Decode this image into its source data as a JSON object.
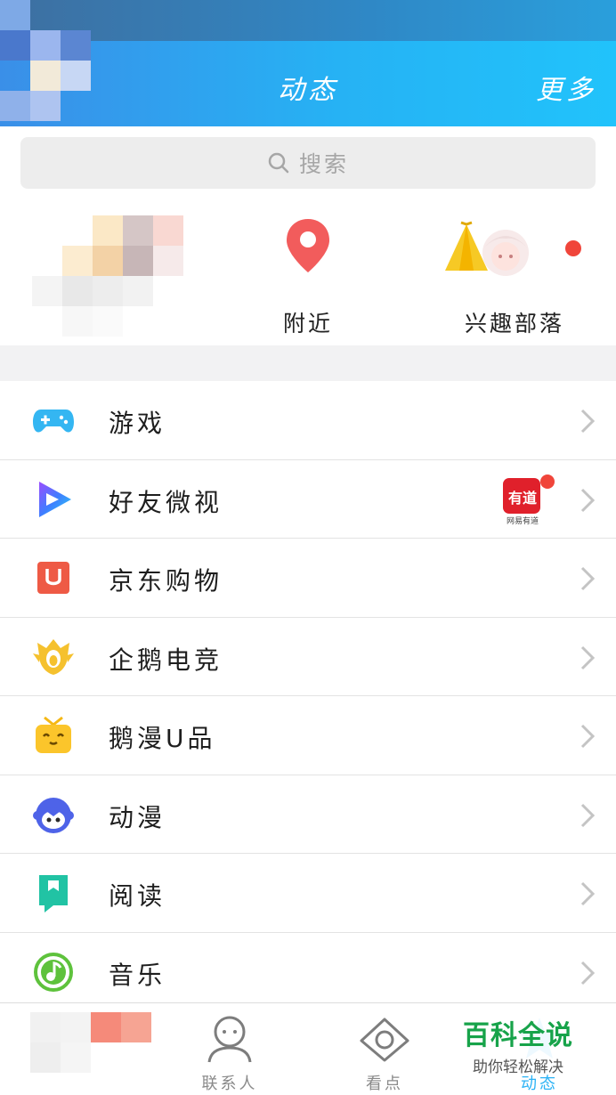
{
  "header": {
    "title": "动态",
    "more_label": "更多"
  },
  "search": {
    "placeholder": "搜索"
  },
  "quick_entries": [
    {
      "label": "附近",
      "icon": "location-pin-icon"
    },
    {
      "label": "兴趣部落",
      "icon": "tent-icon",
      "has_red_dot": true
    }
  ],
  "list": [
    {
      "label": "游戏",
      "icon": "gamepad-icon"
    },
    {
      "label": "好友微视",
      "icon": "weishi-play-icon",
      "badge_app": "有道",
      "badge_caption": "网易有道",
      "badge_red_dot": true
    },
    {
      "label": "京东购物",
      "icon": "jd-shopping-icon"
    },
    {
      "label": "企鹅电竞",
      "icon": "penguin-esports-icon"
    },
    {
      "label": "鹅漫U品",
      "icon": "gift-box-icon"
    },
    {
      "label": "动漫",
      "icon": "anime-face-icon"
    },
    {
      "label": "阅读",
      "icon": "bookmark-icon"
    },
    {
      "label": "音乐",
      "icon": "music-note-icon"
    }
  ],
  "bottom_nav": {
    "items": [
      {
        "label": "联系人",
        "icon": "contacts-icon"
      },
      {
        "label": "看点",
        "icon": "eye-icon"
      },
      {
        "label": "动态",
        "icon": "star-icon",
        "active": true
      }
    ]
  },
  "watermark": {
    "title": "百科全说",
    "subtitle": "助你轻松解决"
  },
  "colors": {
    "header_start": "#3a8fe8",
    "header_end": "#21c3fb",
    "active_tab": "#2bb2f5",
    "red_dot": "#f0453a",
    "watermark_green": "#17a34a"
  }
}
